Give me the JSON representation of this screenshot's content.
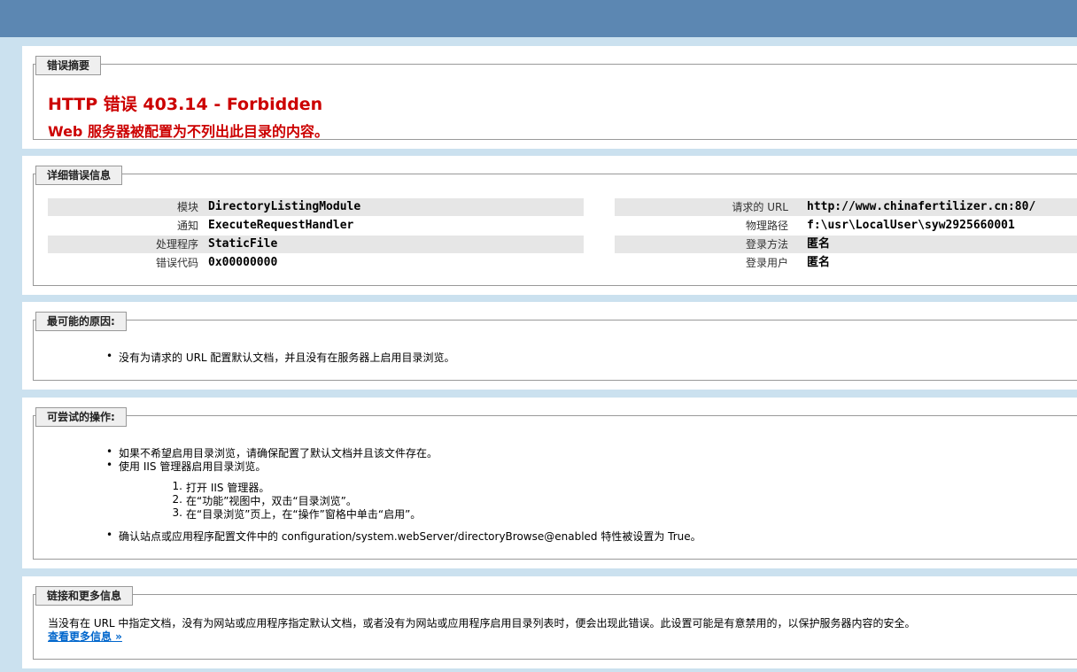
{
  "summary": {
    "legend": "错误摘要",
    "title": "HTTP 错误 403.14 - Forbidden",
    "subtitle": "Web 服务器被配置为不列出此目录的内容。"
  },
  "details": {
    "legend": "详细错误信息",
    "left": [
      {
        "key": "模块",
        "value": "DirectoryListingModule"
      },
      {
        "key": "通知",
        "value": "ExecuteRequestHandler"
      },
      {
        "key": "处理程序",
        "value": "StaticFile"
      },
      {
        "key": "错误代码",
        "value": "0x00000000"
      }
    ],
    "right": [
      {
        "key": "请求的 URL",
        "value": "http://www.chinafertilizer.cn:80/"
      },
      {
        "key": "物理路径",
        "value": "f:\\usr\\LocalUser\\syw2925660001"
      },
      {
        "key": "登录方法",
        "value": "匿名"
      },
      {
        "key": "登录用户",
        "value": "匿名"
      }
    ]
  },
  "causes": {
    "legend": "最可能的原因:",
    "items": [
      "没有为请求的 URL 配置默认文档，并且没有在服务器上启用目录浏览。"
    ]
  },
  "actions": {
    "legend": "可尝试的操作:",
    "items": [
      "如果不希望启用目录浏览，请确保配置了默认文档并且该文件存在。",
      "使用 IIS 管理器启用目录浏览。"
    ],
    "steps": [
      {
        "n": "1.",
        "text": "打开 IIS 管理器。"
      },
      {
        "n": "2.",
        "text": "在“功能”视图中，双击“目录浏览”。"
      },
      {
        "n": "3.",
        "text": "在“目录浏览”页上，在“操作”窗格中单击“启用”。"
      }
    ],
    "last": "确认站点或应用程序配置文件中的 configuration/system.webServer/directoryBrowse@enabled 特性被设置为 True。"
  },
  "links": {
    "legend": "链接和更多信息",
    "text": "当没有在 URL 中指定文档，没有为网站或应用程序指定默认文档，或者没有为网站或应用程序启用目录列表时，便会出现此错误。此设置可能是有意禁用的，以保护服务器内容的安全。",
    "more": "查看更多信息 »"
  }
}
